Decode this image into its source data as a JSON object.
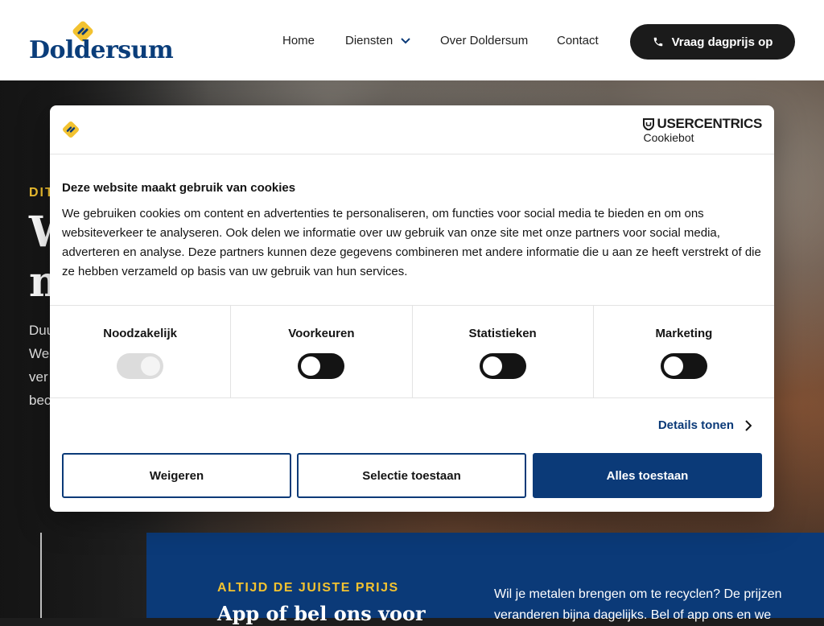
{
  "header": {
    "logo_text": "Doldersum",
    "nav": [
      {
        "label": "Home"
      },
      {
        "label": "Diensten"
      },
      {
        "label": "Over Doldersum"
      },
      {
        "label": "Contact"
      }
    ],
    "cta_label": "Vraag dagprijs op"
  },
  "hero": {
    "eyebrow": "DIT",
    "title_line1": "W",
    "title_line2": "m",
    "body_lines": [
      "Duu",
      "We",
      "ver",
      "bec"
    ]
  },
  "panel": {
    "eyebrow": "ALTIJD DE JUISTE PRIJS",
    "title": "App of bel ons voor",
    "body": "Wil je metalen brengen om te recyclen? De prijzen veranderen bijna dagelijks. Bel of app ons en we"
  },
  "cookie": {
    "brand_top": "USERCENTRICS",
    "brand_sub": "Cookiebot",
    "title": "Deze website maakt gebruik van cookies",
    "text": "We gebruiken cookies om content en advertenties te personaliseren, om functies voor social media te bieden en om ons websiteverkeer te analyseren. Ook delen we informatie over uw gebruik van onze site met onze partners voor social media, adverteren en analyse. Deze partners kunnen deze gegevens combineren met andere informatie die u aan ze heeft verstrekt of die ze hebben verzameld op basis van uw gebruik van hun services.",
    "categories": [
      {
        "label": "Noodzakelijk",
        "enabled": true,
        "locked": true
      },
      {
        "label": "Voorkeuren",
        "enabled": false,
        "locked": false
      },
      {
        "label": "Statistieken",
        "enabled": false,
        "locked": false
      },
      {
        "label": "Marketing",
        "enabled": false,
        "locked": false
      }
    ],
    "details_label": "Details tonen",
    "buttons": {
      "deny": "Weigeren",
      "selection": "Selectie toestaan",
      "allow_all": "Alles toestaan"
    }
  },
  "colors": {
    "brand_blue": "#0b3a78",
    "accent_yellow": "#f2c230",
    "dark": "#1b1b1b"
  }
}
